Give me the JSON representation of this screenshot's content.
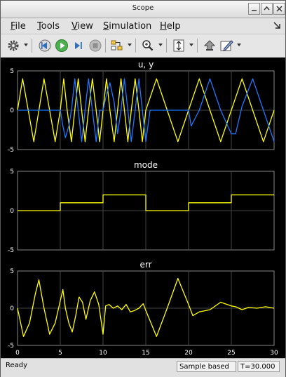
{
  "window": {
    "title": "Scope"
  },
  "menu": {
    "items": [
      {
        "first": "F",
        "rest": "ile"
      },
      {
        "first": "T",
        "rest": "ools"
      },
      {
        "first": "V",
        "rest": "iew"
      },
      {
        "first": "S",
        "rest": "imulation"
      },
      {
        "first": "H",
        "rest": "elp"
      }
    ]
  },
  "toolbar": {
    "icons": [
      "settings-icon",
      "step-back-icon",
      "run-icon",
      "step-forward-icon",
      "stop-icon",
      "highlight-block-icon",
      "zoom-icon",
      "autoscale-icon",
      "restore-icon",
      "style-icon"
    ]
  },
  "colors": {
    "yellow": "#ffff00",
    "blue": "#1e78ff",
    "axes_bg": "#000000",
    "grid": "#444444",
    "axis_text": "#ffffff"
  },
  "status": {
    "left": "Ready",
    "mode": "Sample based",
    "time": "T=30.000"
  },
  "chart_data": [
    {
      "type": "line",
      "title": "u, y",
      "ylim": [
        -5,
        5
      ],
      "yticks": [
        "5",
        "0",
        "-5"
      ],
      "xlim": [
        0,
        30
      ],
      "series": [
        {
          "color": "#ffff00",
          "x": [
            0,
            0.6,
            1.25,
            1.9,
            2.5,
            3.1,
            3.75,
            4.4,
            5,
            5.4,
            5.8,
            6.3,
            6.7,
            7.1,
            7.5,
            7.9,
            8.3,
            8.75,
            9.2,
            9.6,
            10,
            10.4,
            10.8,
            11.3,
            11.7,
            12.1,
            12.5,
            12.9,
            13.3,
            13.75,
            14.2,
            14.6,
            15,
            16.25,
            17.5,
            18.75,
            20,
            21.25,
            22.5,
            23.75,
            25,
            26.25,
            27.5,
            28.75,
            30
          ],
          "y": [
            0,
            4,
            0,
            -4,
            0,
            4,
            0,
            -4,
            0,
            4,
            0,
            -4,
            0,
            4,
            0,
            -4,
            0,
            4,
            0,
            -4,
            0,
            4,
            0,
            -4,
            0,
            4,
            0,
            -4,
            0,
            4,
            0,
            -4,
            0,
            4,
            0,
            -4,
            0,
            4,
            0,
            -4,
            0,
            4,
            0,
            -4,
            0
          ]
        },
        {
          "color": "#1e78ff",
          "x": [
            0,
            5,
            5.3,
            5.6,
            6,
            6.3,
            6.7,
            7.1,
            7.5,
            7.9,
            8.3,
            8.75,
            9.2,
            9.6,
            10,
            10.4,
            10.8,
            11.3,
            11.7,
            12.1,
            12.5,
            12.9,
            13.3,
            13.75,
            14.2,
            14.6,
            15,
            15.5,
            20,
            20.3,
            21.25,
            22.5,
            23.75,
            25,
            25.5,
            26.25,
            27.5,
            28.75,
            30
          ],
          "y": [
            0,
            0,
            -2,
            -3.5,
            -2,
            0,
            4,
            0,
            -4,
            0,
            4,
            0,
            -4,
            0,
            0,
            2,
            3.5,
            1,
            -3,
            0,
            4,
            0,
            -4,
            0,
            4,
            0,
            -4,
            0,
            0,
            -2,
            0,
            4,
            0,
            -3,
            -3,
            0.5,
            4,
            0,
            -4
          ]
        }
      ]
    },
    {
      "type": "line",
      "title": "mode",
      "ylim": [
        -5,
        5
      ],
      "yticks": [
        "5",
        "0",
        "-5"
      ],
      "xlim": [
        0,
        30
      ],
      "series": [
        {
          "color": "#ffff00",
          "x": [
            0,
            5,
            5,
            10,
            10,
            15,
            15,
            20,
            20,
            25,
            25,
            30
          ],
          "y": [
            0,
            0,
            1,
            1,
            2,
            2,
            0,
            0,
            1,
            1,
            2,
            2
          ]
        }
      ]
    },
    {
      "type": "line",
      "title": "err",
      "ylim": [
        -5,
        5
      ],
      "yticks": [
        "5",
        "0",
        "-5"
      ],
      "xlim": [
        0,
        30
      ],
      "xticks": [
        "0",
        "5",
        "10",
        "15",
        "20",
        "25",
        "30"
      ],
      "series": [
        {
          "color": "#ffff00",
          "x": [
            0,
            0.7,
            1.4,
            2.1,
            2.5,
            3.1,
            3.75,
            4.4,
            5,
            5.3,
            5.6,
            6,
            6.4,
            6.8,
            7.2,
            7.6,
            8,
            8.5,
            9,
            9.5,
            10,
            10.3,
            10.7,
            11.2,
            11.7,
            12.2,
            12.7,
            13.2,
            13.7,
            14.2,
            14.7,
            15,
            16.25,
            17.5,
            18.75,
            20,
            20.5,
            21.25,
            22.5,
            23,
            23.75,
            25,
            25.5,
            26.25,
            27,
            28,
            29,
            30
          ],
          "y": [
            0,
            -3.8,
            -2,
            2,
            3.8,
            0,
            -3.5,
            -2,
            1,
            2.5,
            0,
            -2,
            -3.2,
            -1,
            1.5,
            0.8,
            -1.5,
            1,
            2.2,
            0.5,
            -3.5,
            0.3,
            0.5,
            0,
            0.3,
            -0.2,
            0.5,
            -0.5,
            -0.3,
            0,
            0.6,
            -0.3,
            -3.8,
            0,
            4,
            0.5,
            -1,
            -0.5,
            -0.2,
            0.2,
            0.8,
            0.3,
            0.2,
            -0.2,
            0.1,
            0,
            0.2,
            0
          ]
        }
      ]
    }
  ]
}
